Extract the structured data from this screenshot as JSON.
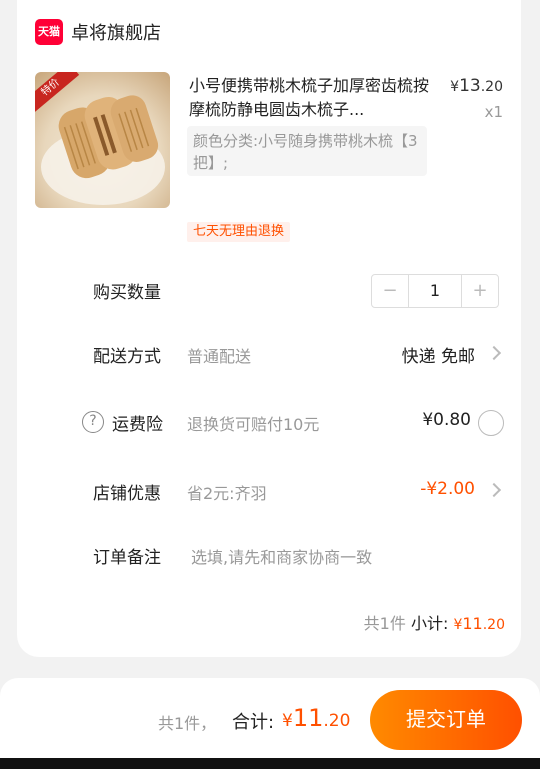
{
  "shop": {
    "logo_text": "天猫",
    "name": "卓将旗舰店"
  },
  "product": {
    "title": "小号便携带桃木梳子加厚密齿梳按摩梳防静电圆齿木梳子...",
    "sku": "颜色分类:小号随身携带桃木梳【3把】;",
    "price_symbol": "¥",
    "price_int": "13",
    "price_dec": ".20",
    "quantity_label": "x1",
    "return_badge": "七天无理由退换",
    "image_tag": "特价"
  },
  "quantity": {
    "label": "购买数量",
    "minus": "−",
    "value": "1",
    "plus": "+"
  },
  "delivery": {
    "label": "配送方式",
    "method": "普通配送",
    "right": "快递 免邮"
  },
  "insurance": {
    "icon": "?",
    "label": "运费险",
    "desc": "退换货可赔付10元",
    "price": "¥0.80"
  },
  "discount": {
    "label": "店铺优惠",
    "desc": "省2元:齐羽",
    "amount": "-¥2.00"
  },
  "remark": {
    "label": "订单备注",
    "placeholder": "选填,请先和商家协商一致"
  },
  "subtotal": {
    "count": "共1件",
    "label": "小计:",
    "symbol": "¥",
    "int": "11",
    "dec": ".20"
  },
  "footer": {
    "count": "共1件，",
    "total_label": "合计:",
    "symbol": "¥",
    "int": "11",
    "dec": ".20",
    "submit": "提交订单"
  },
  "colors": {
    "accent": "#ff5000",
    "tmall": "#ff0036"
  }
}
